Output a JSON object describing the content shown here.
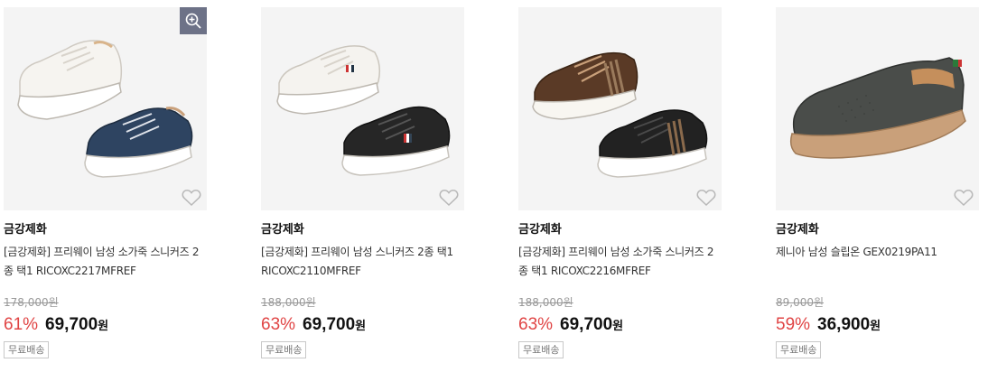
{
  "products": [
    {
      "brand": "금강제화",
      "title": "[금강제화] 프리웨이 남성 소가죽 스니커즈 2종 택1 RICOXC2217MFREF",
      "original_price": "178,000원",
      "discount": "61%",
      "sale_price": "69,700",
      "currency": "원",
      "badge": "무료배송",
      "has_zoom": true
    },
    {
      "brand": "금강제화",
      "title": "[금강제화] 프리웨이 남성 스니커즈 2종 택1 RICOXC2110MFREF",
      "original_price": "188,000원",
      "discount": "63%",
      "sale_price": "69,700",
      "currency": "원",
      "badge": "무료배송",
      "has_zoom": false
    },
    {
      "brand": "금강제화",
      "title": "[금강제화] 프리웨이 남성 소가죽 스니커즈 2종 택1 RICOXC2216MFREF",
      "original_price": "188,000원",
      "discount": "63%",
      "sale_price": "69,700",
      "currency": "원",
      "badge": "무료배송",
      "has_zoom": false
    },
    {
      "brand": "금강제화",
      "title": "제니아 남성 슬립온 GEX0219PA11",
      "original_price": "89,000원",
      "discount": "59%",
      "sale_price": "36,900",
      "currency": "원",
      "badge": "무료배송",
      "has_zoom": false
    }
  ],
  "icons": {
    "zoom": "zoom-in-icon",
    "wishlist": "heart-outline-icon"
  },
  "colors": {
    "discount": "#e04444",
    "zoom_bg": "#6d7287"
  }
}
